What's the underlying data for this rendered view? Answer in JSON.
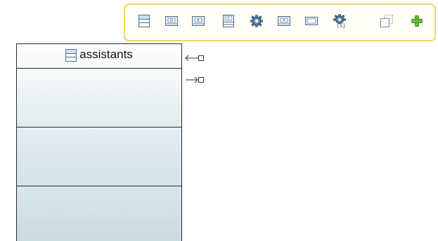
{
  "palette": {
    "tools": [
      {
        "name": "table-icon",
        "label": ""
      },
      {
        "name": "data-column-icon",
        "label": ""
      },
      {
        "name": "enum-column-icon",
        "label": ""
      },
      {
        "name": "index-icon",
        "label": ""
      },
      {
        "name": "gear-icon",
        "label": ""
      },
      {
        "name": "parameter-icon",
        "label": ""
      },
      {
        "name": "view-icon",
        "label": ""
      },
      {
        "name": "stored-procedure-icon",
        "label": ""
      },
      {
        "name": "dashed-box-icon",
        "label": ""
      },
      {
        "name": "plus-icon",
        "label": ""
      }
    ],
    "border_color": "#f2d36a"
  },
  "table": {
    "name": "assistants",
    "icon": "table-icon"
  },
  "handles": {
    "incoming": "arrow-left-connector-icon",
    "outgoing": "arrow-right-connector-icon"
  }
}
